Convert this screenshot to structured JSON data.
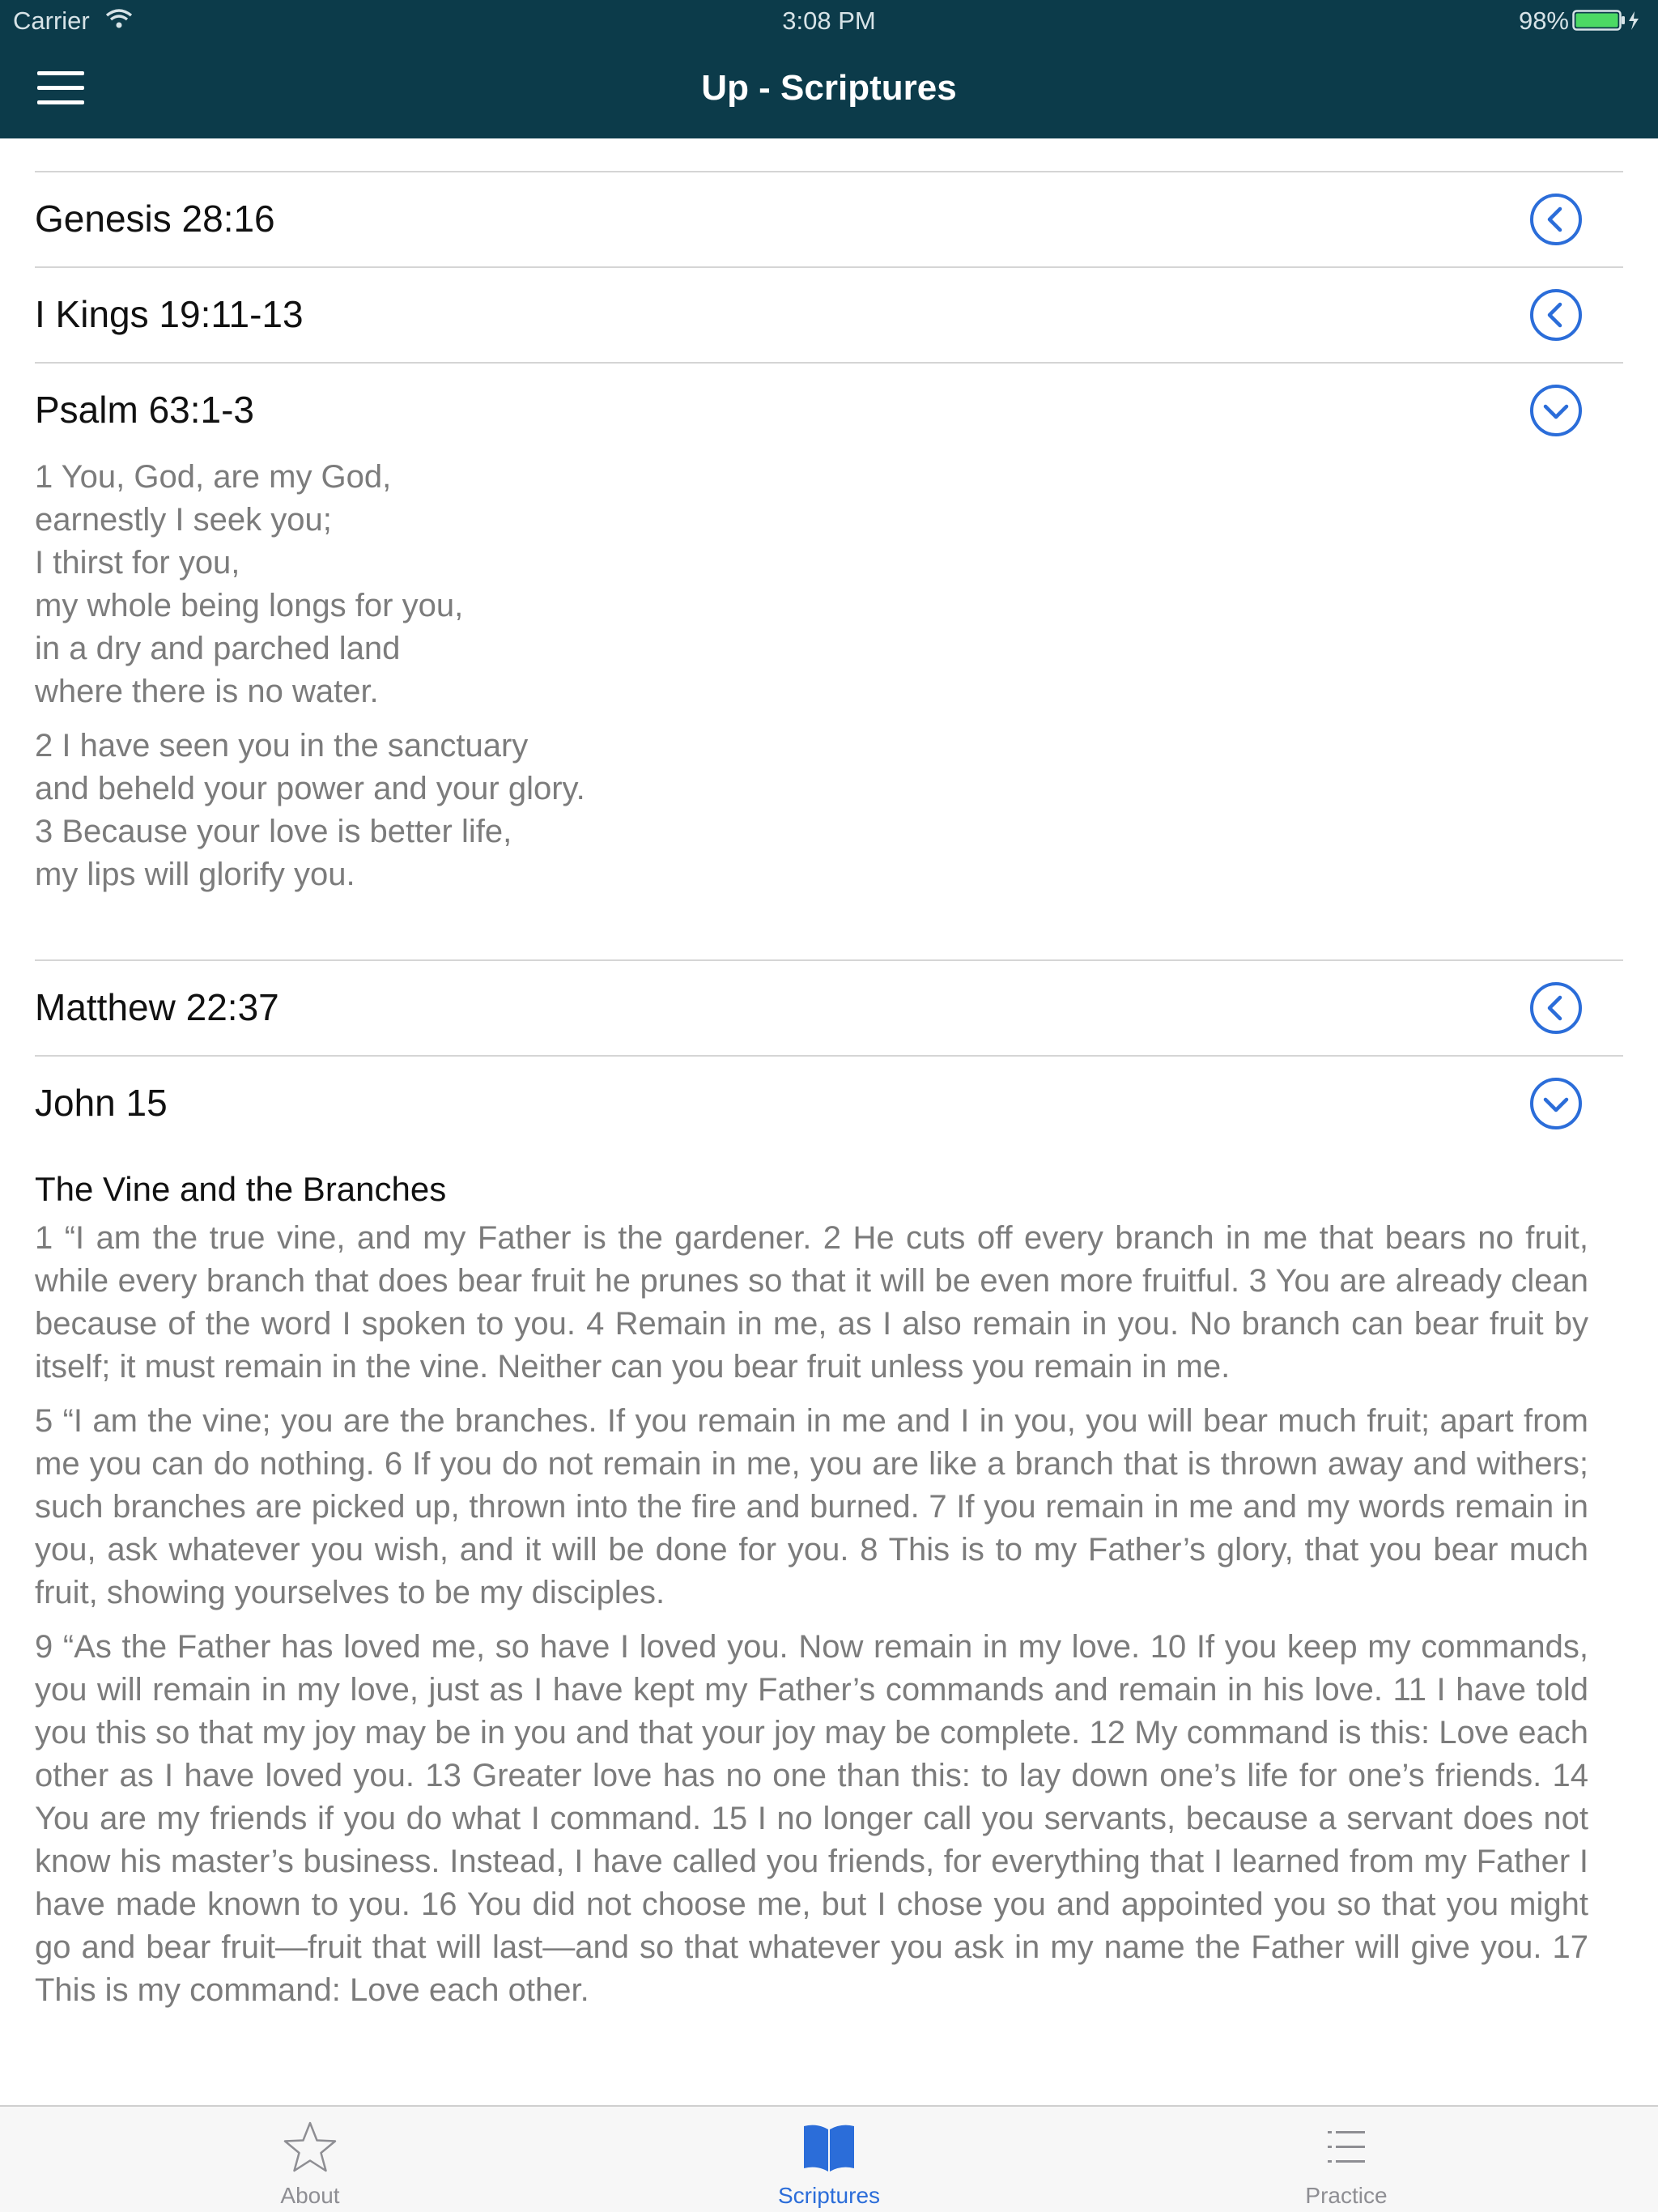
{
  "status_bar": {
    "carrier": "Carrier",
    "time": "3:08 PM",
    "battery": "98%",
    "battery_color": "#4cd964"
  },
  "header": {
    "title": "Up - Scriptures",
    "menu_icon": "hamburger-menu-icon",
    "background_color": "#0c3b4a"
  },
  "accent_color": "#2b6dd9",
  "scriptures": [
    {
      "reference": "Genesis 28:16",
      "state": "collapsed",
      "icon": "chevron-left-circle-icon"
    },
    {
      "reference": "I Kings 19:11-13",
      "state": "collapsed",
      "icon": "chevron-left-circle-icon"
    },
    {
      "reference": "Psalm 63:1-3",
      "state": "expanded",
      "icon": "chevron-down-circle-icon"
    },
    {
      "reference": "Matthew 22:37",
      "state": "collapsed",
      "icon": "chevron-left-circle-icon"
    },
    {
      "reference": "John 15",
      "state": "expanded",
      "icon": "chevron-down-circle-icon"
    }
  ],
  "psalm_63": {
    "stanza1": [
      "1 You, God, are my God,",
      "earnestly I seek you;",
      "I thirst for you,",
      "my whole being longs for you,",
      "in a dry and parched land",
      "where there is no water."
    ],
    "stanza2": [
      "2 I have seen you in the sanctuary",
      "and beheld your power and your glory.",
      "3 Because your love is better life,",
      "my lips will glorify you."
    ]
  },
  "john_15": {
    "heading": "The Vine and the Branches",
    "paragraphs": [
      "1 “I am the true vine, and my Father is the gardener. 2 He cuts off every branch in me that bears no fruit, while every branch that does bear fruit he prunes so that it will be even more fruitful. 3 You are already clean because of the word I spoken to you. 4 Remain in me, as I also remain in you. No branch can bear fruit by itself; it must remain in the vine. Neither can you bear fruit unless you remain in me.",
      "5 “I am the vine; you are the branches. If you remain in me and I in you, you will bear much fruit; apart from me you can do nothing. 6 If you do not remain in me, you are like a branch that is thrown away and withers; such branches are picked up, thrown into the fire and burned. 7 If you remain in me and my words remain in you, ask whatever you wish, and it will be done for you. 8 This is to my Father’s glory, that you bear much fruit, showing yourselves to be my disciples.",
      "9 “As the Father has loved me, so have I loved you. Now remain in my love. 10 If you keep my commands, you will remain in my love, just as I have kept my Father’s commands and remain in his love. 11 I have told you this so that my joy may be in you and that your joy may be complete. 12 My command is this: Love each other as I have loved you. 13 Greater love has no one than this: to lay down one’s life for one’s friends. 14 You are my friends if you do what I command. 15 I no longer call you servants, because a servant does not know his master’s business. Instead, I have called you friends, for everything that I learned from my Father I have made known to you. 16 You did not choose me, but I chose you and appointed you so that you might go and bear fruit—fruit that will last—and so that whatever you ask in my name the Father will give you. 17 This is my command: Love each other."
    ]
  },
  "tab_bar": {
    "tabs": [
      {
        "label": "About",
        "icon": "star-icon",
        "active": false
      },
      {
        "label": "Scriptures",
        "icon": "book-icon",
        "active": true
      },
      {
        "label": "Practice",
        "icon": "list-icon",
        "active": false
      }
    ]
  }
}
